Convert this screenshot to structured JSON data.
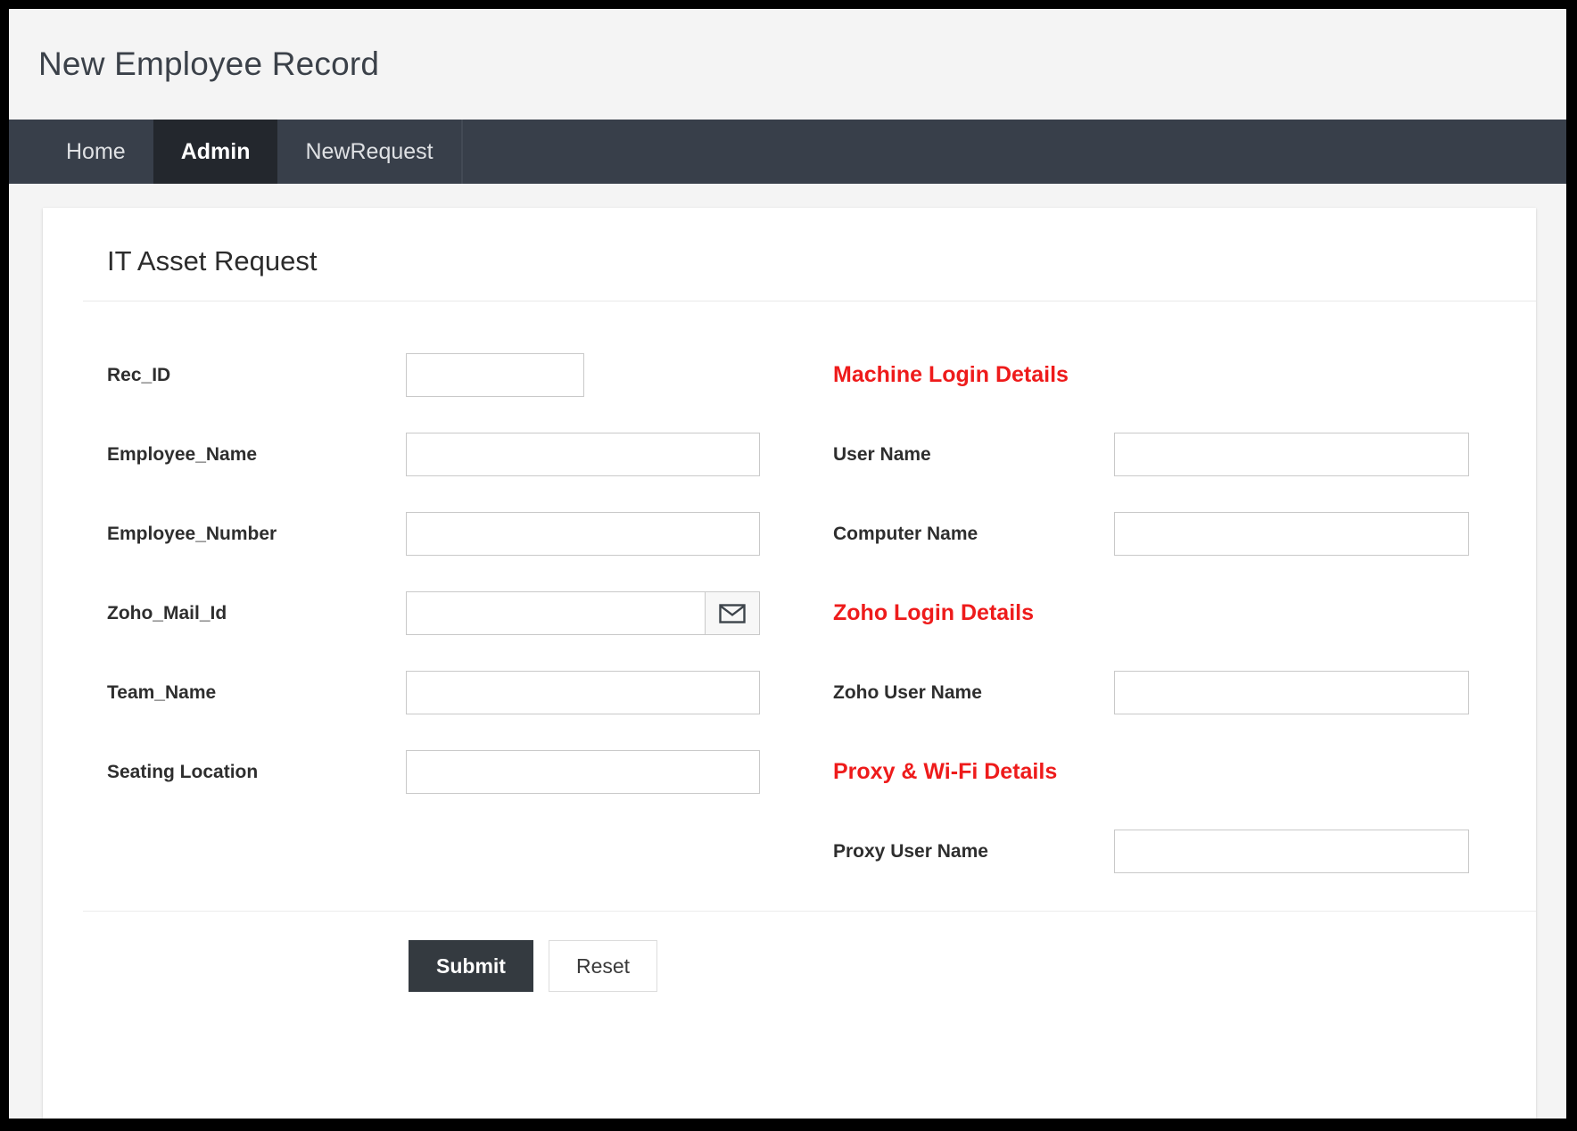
{
  "header": {
    "page_title": "New Employee Record"
  },
  "nav": {
    "items": [
      {
        "label": "Home",
        "active": false
      },
      {
        "label": "Admin",
        "active": true
      },
      {
        "label": "NewRequest",
        "active": false
      }
    ]
  },
  "card": {
    "title": "IT Asset Request"
  },
  "form": {
    "left_fields": [
      {
        "label": "Rec_ID",
        "value": "",
        "placeholder": "",
        "size": "small"
      },
      {
        "label": "Employee_Name",
        "value": "",
        "placeholder": "",
        "size": "normal"
      },
      {
        "label": "Employee_Number",
        "value": "",
        "placeholder": "",
        "size": "normal"
      },
      {
        "label": "Zoho_Mail_Id",
        "value": "",
        "placeholder": "",
        "size": "normal",
        "addon_icon": "envelope-icon"
      },
      {
        "label": "Team_Name",
        "value": "",
        "placeholder": "",
        "size": "normal"
      },
      {
        "label": "Seating Location",
        "value": "",
        "placeholder": "",
        "size": "normal"
      }
    ],
    "right_sections": [
      {
        "heading": "Machine Login Details",
        "heading_color": "#ee1b1b",
        "fields": [
          {
            "label": "User Name",
            "value": "",
            "placeholder": ""
          },
          {
            "label": "Computer Name",
            "value": "",
            "placeholder": ""
          }
        ]
      },
      {
        "heading": "Zoho Login Details",
        "heading_color": "#ee1b1b",
        "fields": [
          {
            "label": "Zoho User Name",
            "value": "",
            "placeholder": ""
          }
        ]
      },
      {
        "heading": "Proxy & Wi-Fi Details",
        "heading_color": "#ee1b1b",
        "fields": [
          {
            "label": "Proxy User Name",
            "value": "",
            "placeholder": ""
          }
        ]
      }
    ]
  },
  "actions": {
    "submit_label": "Submit",
    "reset_label": "Reset"
  },
  "colors": {
    "navbar": "#383f4a",
    "nav_active": "#23272d",
    "page_background": "#f4f4f4",
    "card_background": "#ffffff",
    "accent_red": "#ee1b1b",
    "primary_button": "#343a40",
    "input_border": "#c9c9c9"
  }
}
